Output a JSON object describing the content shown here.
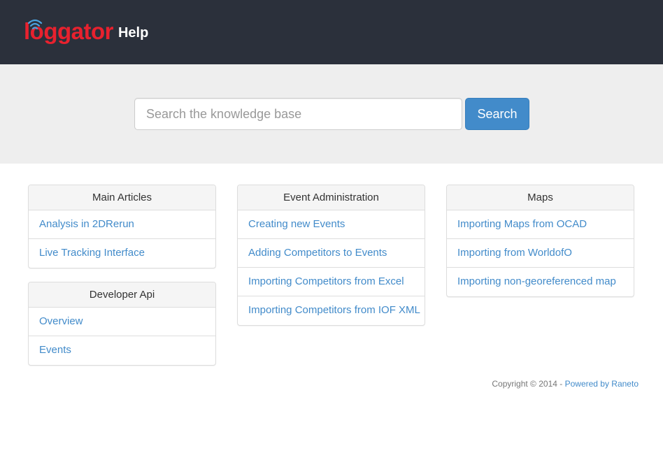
{
  "header": {
    "logo_text": "loggator",
    "help_label": "Help",
    "brand_color": "#e8212e",
    "background": "#2b303b"
  },
  "search": {
    "placeholder": "Search the knowledge base",
    "value": "",
    "button_label": "Search",
    "button_color": "#428bca"
  },
  "panels": {
    "main_articles": {
      "title": "Main Articles",
      "items": [
        "Analysis in 2DRerun",
        "Live Tracking Interface"
      ]
    },
    "developer_api": {
      "title": "Developer Api",
      "items": [
        "Overview",
        "Events"
      ]
    },
    "event_administration": {
      "title": "Event Administration",
      "items": [
        "Creating new Events",
        "Adding Competitors to Events",
        "Importing Competitors from Excel",
        "Importing Competitors from IOF XML"
      ]
    },
    "maps": {
      "title": "Maps",
      "items": [
        "Importing Maps from OCAD",
        "Importing from WorldofO",
        "Importing non-georeferenced map"
      ]
    }
  },
  "footer": {
    "copyright": "Copyright © 2014 - ",
    "powered_link": "Powered by Raneto"
  },
  "link_color": "#428bca"
}
